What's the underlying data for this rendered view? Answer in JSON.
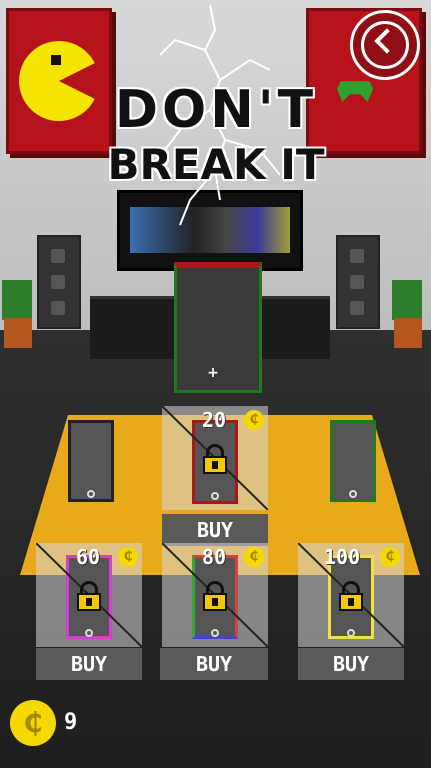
{
  "title": {
    "line1": "DON'T",
    "line2": "BREAK IT"
  },
  "back_button": {
    "icon": "chevron-left-icon"
  },
  "currency_symbol": "₵",
  "wallet": {
    "coins": "9"
  },
  "skins": [
    {
      "id": "gray",
      "locked": false,
      "border_color": "#222222"
    },
    {
      "id": "red",
      "locked": true,
      "price": "20",
      "border_color": "#a71919",
      "buy_label": "BUY"
    },
    {
      "id": "green",
      "locked": false,
      "border_color": "#1f7a1f"
    },
    {
      "id": "purple",
      "locked": true,
      "price": "60",
      "border_color": "#d33fd3",
      "buy_label": "BUY"
    },
    {
      "id": "rainbow",
      "locked": true,
      "price": "80",
      "border_color": "#c44",
      "buy_label": "BUY"
    },
    {
      "id": "yellow",
      "locked": true,
      "price": "100",
      "border_color": "#f0e040",
      "buy_label": "BUY"
    }
  ],
  "colors": {
    "coin": "#f5d800",
    "table": "#e8a91a",
    "buy_button": "#5a5a5a"
  }
}
